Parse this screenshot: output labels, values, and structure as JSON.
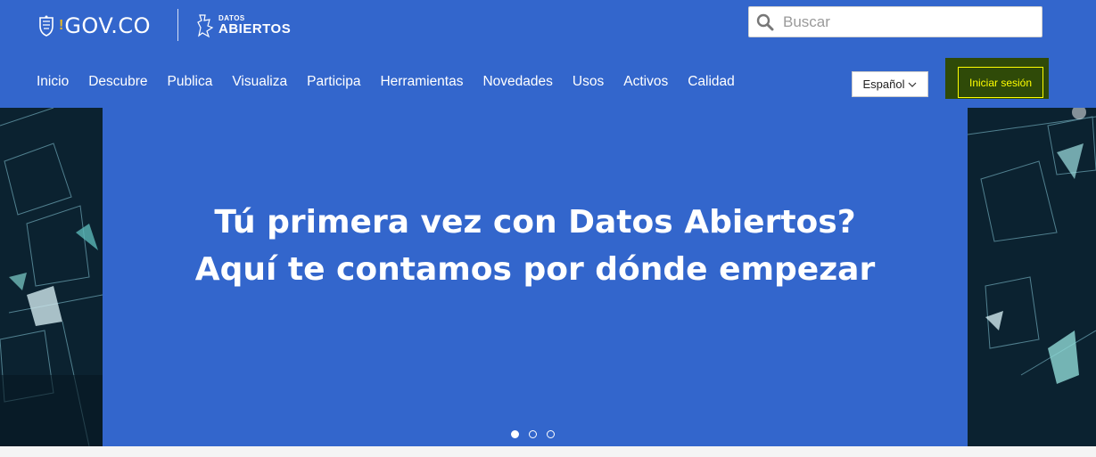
{
  "header": {
    "gov_logo_text": "GOV.CO",
    "gov_logo_exclamation": "!",
    "datos_logo_small": "DATOS",
    "datos_logo_big": "ABIERTOS",
    "search": {
      "placeholder": "Buscar",
      "value": ""
    }
  },
  "nav": {
    "items": [
      {
        "label": "Inicio"
      },
      {
        "label": "Descubre"
      },
      {
        "label": "Publica"
      },
      {
        "label": "Visualiza"
      },
      {
        "label": "Participa"
      },
      {
        "label": "Herramientas"
      },
      {
        "label": "Novedades"
      },
      {
        "label": "Usos"
      },
      {
        "label": "Activos"
      },
      {
        "label": "Calidad"
      }
    ],
    "language": "Español",
    "login": "Iniciar sesión"
  },
  "hero": {
    "title_line1": "Tú primera vez con Datos Abiertos?",
    "title_line2": "Aquí te contamos por dónde empezar",
    "slides": 3,
    "active_slide": 1
  },
  "colors": {
    "primary_blue": "#3366cc",
    "login_text": "#ffff00",
    "login_bg": "#2f4a08"
  }
}
